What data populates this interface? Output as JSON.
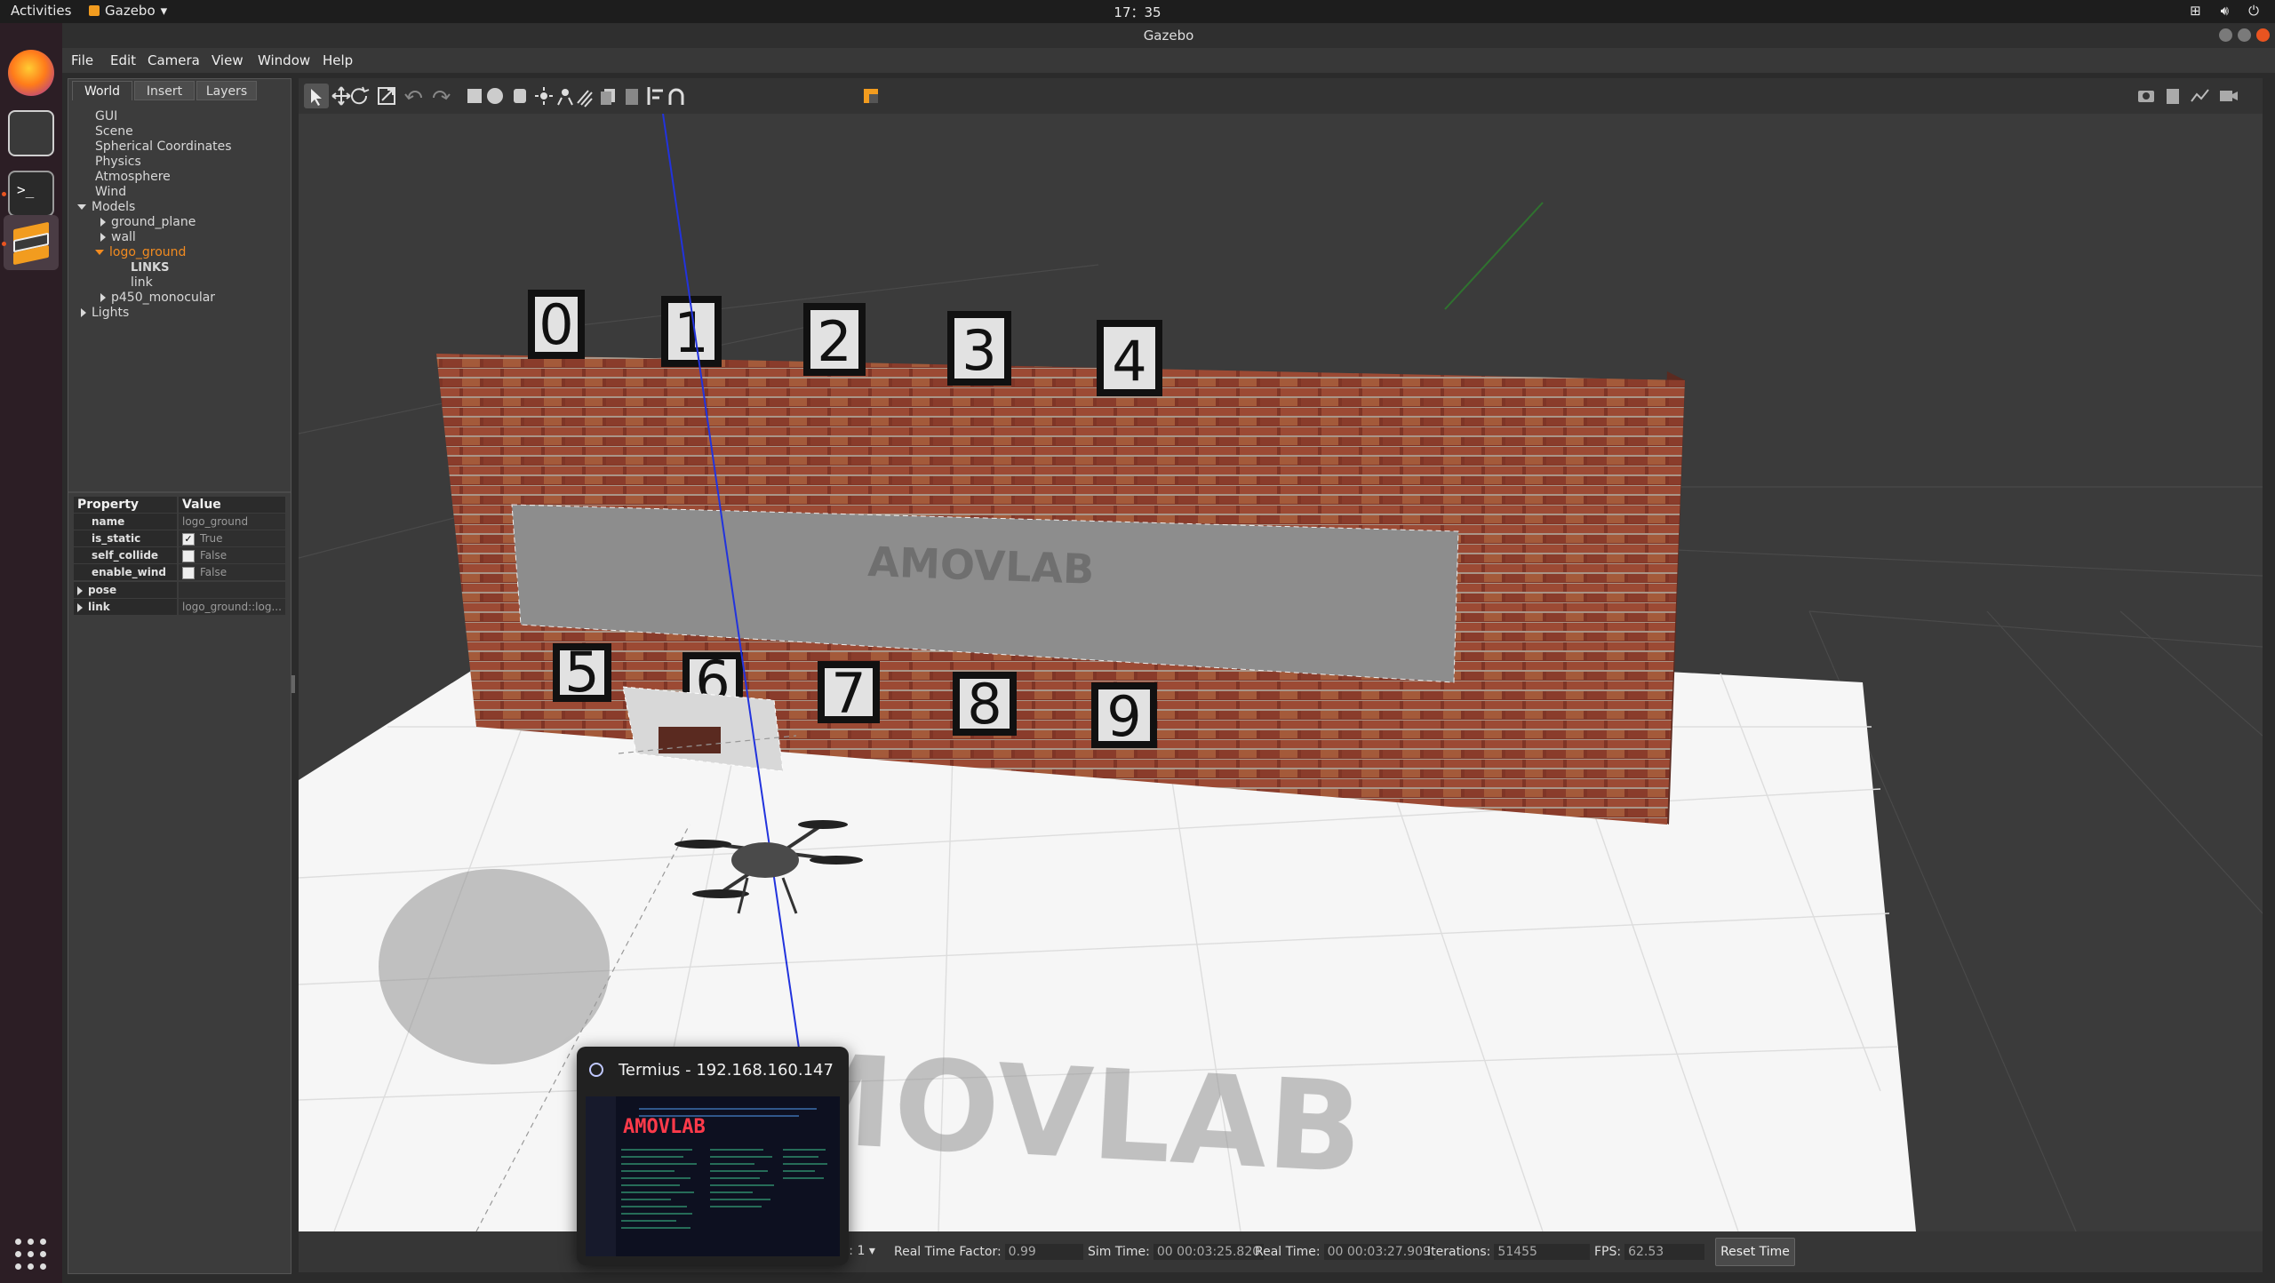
{
  "topbar": {
    "activities": "Activities",
    "app_name": "Gazebo",
    "clock": "17：35"
  },
  "window": {
    "title": "Gazebo"
  },
  "menubar": {
    "items": [
      "File",
      "Edit",
      "Camera",
      "View",
      "Window",
      "Help"
    ]
  },
  "left_panel": {
    "tabs": [
      "World",
      "Insert",
      "Layers"
    ],
    "active_tab": "World",
    "tree": {
      "items": [
        "GUI",
        "Scene",
        "Spherical Coordinates",
        "Physics",
        "Atmosphere",
        "Wind"
      ],
      "models_label": "Models",
      "models": [
        "ground_plane",
        "wall",
        "logo_ground",
        "p450_monocular"
      ],
      "selected_model": "logo_ground",
      "links_label": "LINKS",
      "link_child": "link",
      "lights_label": "Lights"
    },
    "properties": {
      "header_property": "Property",
      "header_value": "Value",
      "rows": [
        {
          "key": "name",
          "value": "logo_ground"
        },
        {
          "key": "is_static",
          "value": "True",
          "checked": true
        },
        {
          "key": "self_collide",
          "value": "False",
          "checked": false
        },
        {
          "key": "enable_wind",
          "value": "False",
          "checked": false
        }
      ],
      "pose_label": "pose",
      "link_label": "link",
      "link_value": "logo_ground::log..."
    }
  },
  "scene": {
    "top_numbers": [
      "0",
      "1",
      "2",
      "3",
      "4"
    ],
    "bottom_numbers": [
      "5",
      "6",
      "7",
      "8",
      "9"
    ],
    "logo_text": "AMOVLAB"
  },
  "statusbar": {
    "steps_label": "s:",
    "steps_value": "1",
    "rtf_label": "Real Time Factor:",
    "rtf_value": "0.99",
    "sim_time_label": "Sim Time:",
    "sim_time_value": "00 00:03:25.820",
    "real_time_label": "Real Time:",
    "real_time_value": "00 00:03:27.909",
    "iterations_label": "Iterations:",
    "iterations_value": "51455",
    "fps_label": "FPS:",
    "fps_value": "62.53",
    "reset_label": "Reset Time"
  },
  "termius": {
    "title": "Termius - 192.168.160.147",
    "banner": "AMOVLAB"
  },
  "colors": {
    "accent_orange": "#f28b20",
    "ubuntu_orange": "#e95420",
    "brick": "#8a3b2a",
    "floor": "#f6f6f6"
  },
  "icons": {
    "dock": [
      "firefox-icon",
      "files-icon",
      "terminal-icon",
      "gazebo-icon",
      "show-apps-icon"
    ],
    "toolbar": [
      "select-icon",
      "translate-icon",
      "rotate-icon",
      "scale-icon",
      "undo-icon",
      "redo-icon",
      "box-icon",
      "sphere-icon",
      "cylinder-icon",
      "point-light-icon",
      "spot-light-icon",
      "directional-light-icon",
      "copy-icon",
      "paste-icon",
      "align-icon",
      "snap-icon",
      "view-angle-icon",
      "screenshot-icon",
      "log-icon",
      "plot-icon",
      "video-icon"
    ]
  }
}
